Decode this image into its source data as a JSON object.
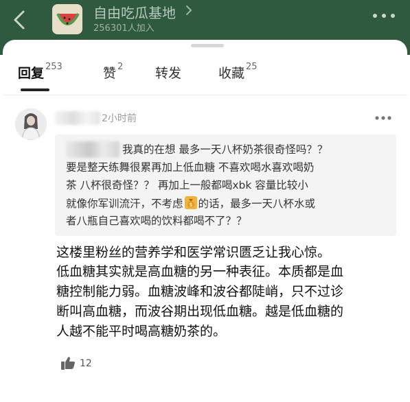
{
  "header": {
    "group_name": "自由吃瓜基地",
    "members": "256301人加入"
  },
  "tabs": [
    {
      "label": "回复",
      "count": "253"
    },
    {
      "label": "赞",
      "count": "2"
    },
    {
      "label": "转发",
      "count": ""
    },
    {
      "label": "收藏",
      "count": "25"
    }
  ],
  "comment": {
    "time": "2小时前",
    "quote": {
      "line1": "我真的在想 最多一天八杯奶茶很奇怪吗？？",
      "line2": "要是整天练舞很累再加上低血糖 不喜欢喝水喜欢喝奶",
      "line3": "茶 八杯很奇怪？？ 再加上一般都喝xbk 容量比较小",
      "line4a": "就像你军训流汗，不考虑",
      "line4b": "的话，最多一天八杯水或",
      "line5": "者八瓶自己喜欢喝的饮料都喝不了？？"
    },
    "body": [
      "这楼里粉丝的营养学和医学常识匮乏让我心惊。",
      "低血糖其实就是高血糖的另一种表征。本质都是血",
      "糖控制能力弱。血糖波峰和波谷都陡峭，只不过诊",
      "断叫高血糖，而波谷期出现低血糖。越是低血糖的",
      "人越不能平时喝高糖奶茶的。"
    ],
    "likes": "12"
  },
  "icons": {
    "back": "chevron-left-icon",
    "more": "more-dots-icon",
    "like": "thumbs-up-icon",
    "money": "money-bag-icon"
  },
  "colors": {
    "header_bg": "#2f5a40",
    "header_text": "#b7c9bd",
    "quote_bg": "#f4f4f4",
    "muted_text": "#999999"
  }
}
